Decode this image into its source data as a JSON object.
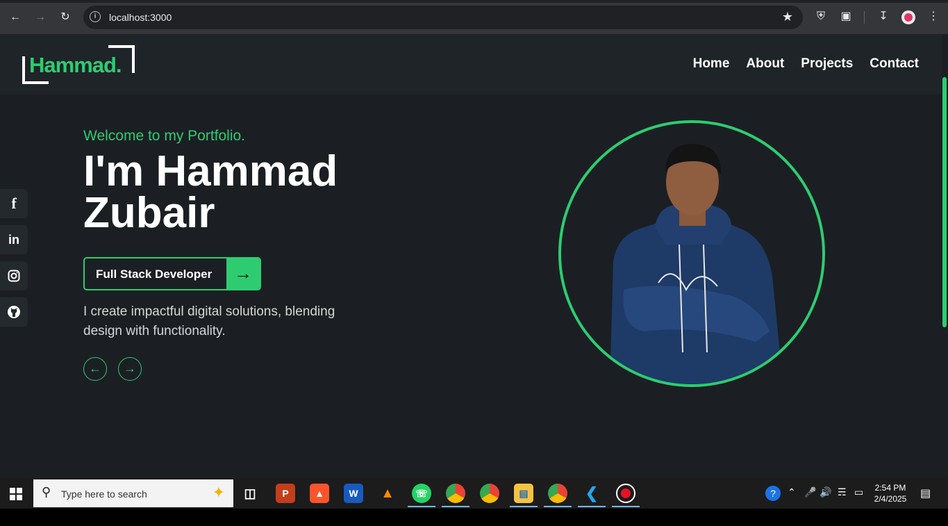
{
  "browser": {
    "url": "localhost:3000"
  },
  "site": {
    "logo_text": "Hammad.",
    "nav": [
      "Home",
      "About",
      "Projects",
      "Contact"
    ],
    "hero": {
      "welcome": "Welcome to my Portfolio.",
      "title_line1": "I'm Hammad",
      "title_line2": "Zubair",
      "role_button": "Full Stack Developer",
      "description": "I create impactful digital solutions, blending design with functionality."
    },
    "social": [
      "facebook-icon",
      "linkedin-icon",
      "instagram-icon",
      "github-icon"
    ],
    "accent_color": "#2ecc71",
    "background_color": "#1b1f23"
  },
  "taskbar": {
    "search_placeholder": "Type here to search",
    "time": "2:54 PM",
    "date": "2/4/2025"
  }
}
